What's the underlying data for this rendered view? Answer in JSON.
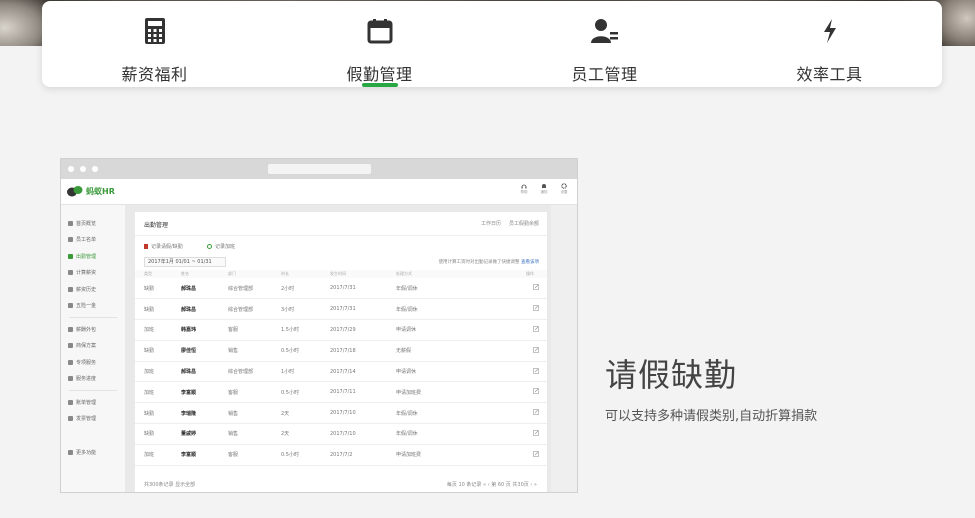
{
  "tabs": [
    {
      "label": "薪资福利",
      "icon": "calculator-icon",
      "active": false
    },
    {
      "label": "假勤管理",
      "icon": "calendar-icon",
      "active": true
    },
    {
      "label": "员工管理",
      "icon": "user-card-icon",
      "active": false
    },
    {
      "label": "效率工具",
      "icon": "lightning-icon",
      "active": false
    }
  ],
  "accent_color": "#28a745",
  "mock": {
    "logo_text": "蚂蚁HR",
    "appbar_icons": [
      {
        "label": "帮助",
        "icon": "headset-icon"
      },
      {
        "label": "通知",
        "icon": "bell-icon"
      },
      {
        "label": "设置",
        "icon": "gear-icon"
      }
    ],
    "sidebar": [
      {
        "label": "首页概览"
      },
      {
        "label": "员工名单"
      },
      {
        "label": "出勤管理",
        "active": true
      },
      {
        "label": "计算薪资"
      },
      {
        "label": "薪资历史"
      },
      {
        "label": "五险一金"
      },
      {
        "label": "薪酬外包"
      },
      {
        "label": "商保方案"
      },
      {
        "label": "专项服务"
      },
      {
        "label": "服务进度"
      },
      {
        "label": "账单管理"
      },
      {
        "label": "发票管理"
      },
      {
        "label": "更多功能"
      }
    ],
    "content": {
      "title": "出勤管理",
      "actions": [
        "工作日历",
        "员工假勤余额"
      ],
      "sub_actions": [
        "记录请假/缺勤",
        "记录加班"
      ],
      "date_range": "2017年1月  01/01 ~ 01/31",
      "tip": "使用计算工资时对出勤记录做了快捷调整",
      "tip_link": "查看该项",
      "headers": [
        "类型",
        "姓名",
        "部门",
        "时长",
        "发生时间",
        "处理方式",
        "操作"
      ],
      "rows": [
        [
          "缺勤",
          "郝珠昌",
          "综合管理部",
          "2小时",
          "2017/7/31",
          "年假/调休"
        ],
        [
          "缺勤",
          "郝珠昌",
          "综合管理部",
          "3小时",
          "2017/7/31",
          "年假/调休"
        ],
        [
          "加班",
          "韩嘉玮",
          "客服",
          "1.5小时",
          "2017/7/29",
          "申请调休"
        ],
        [
          "缺勤",
          "廖佳恒",
          "销售",
          "0.5小时",
          "2017/7/18",
          "无薪假"
        ],
        [
          "加班",
          "郝珠昌",
          "综合管理部",
          "1小时",
          "2017/7/14",
          "申请调休"
        ],
        [
          "加班",
          "李富顺",
          "客服",
          "0.5小时",
          "2017/7/11",
          "申请加班费"
        ],
        [
          "缺勤",
          "李瑞隆",
          "销售",
          "2天",
          "2017/7/10",
          "年假/调休"
        ],
        [
          "缺勤",
          "董戚婷",
          "销售",
          "2天",
          "2017/7/10",
          "年假/调休"
        ],
        [
          "加班",
          "李富顺",
          "客服",
          "0.5小时",
          "2017/7/2",
          "申请加班费"
        ]
      ],
      "footer_left": "共300条记录  显示全部",
      "footer_right": "每页 10 条记录   «  ‹  第 60 页  共30页  ›  »"
    }
  },
  "feature": {
    "title": "请假缺勤",
    "description": "可以支持多种请假类别,自动折算捐款"
  }
}
